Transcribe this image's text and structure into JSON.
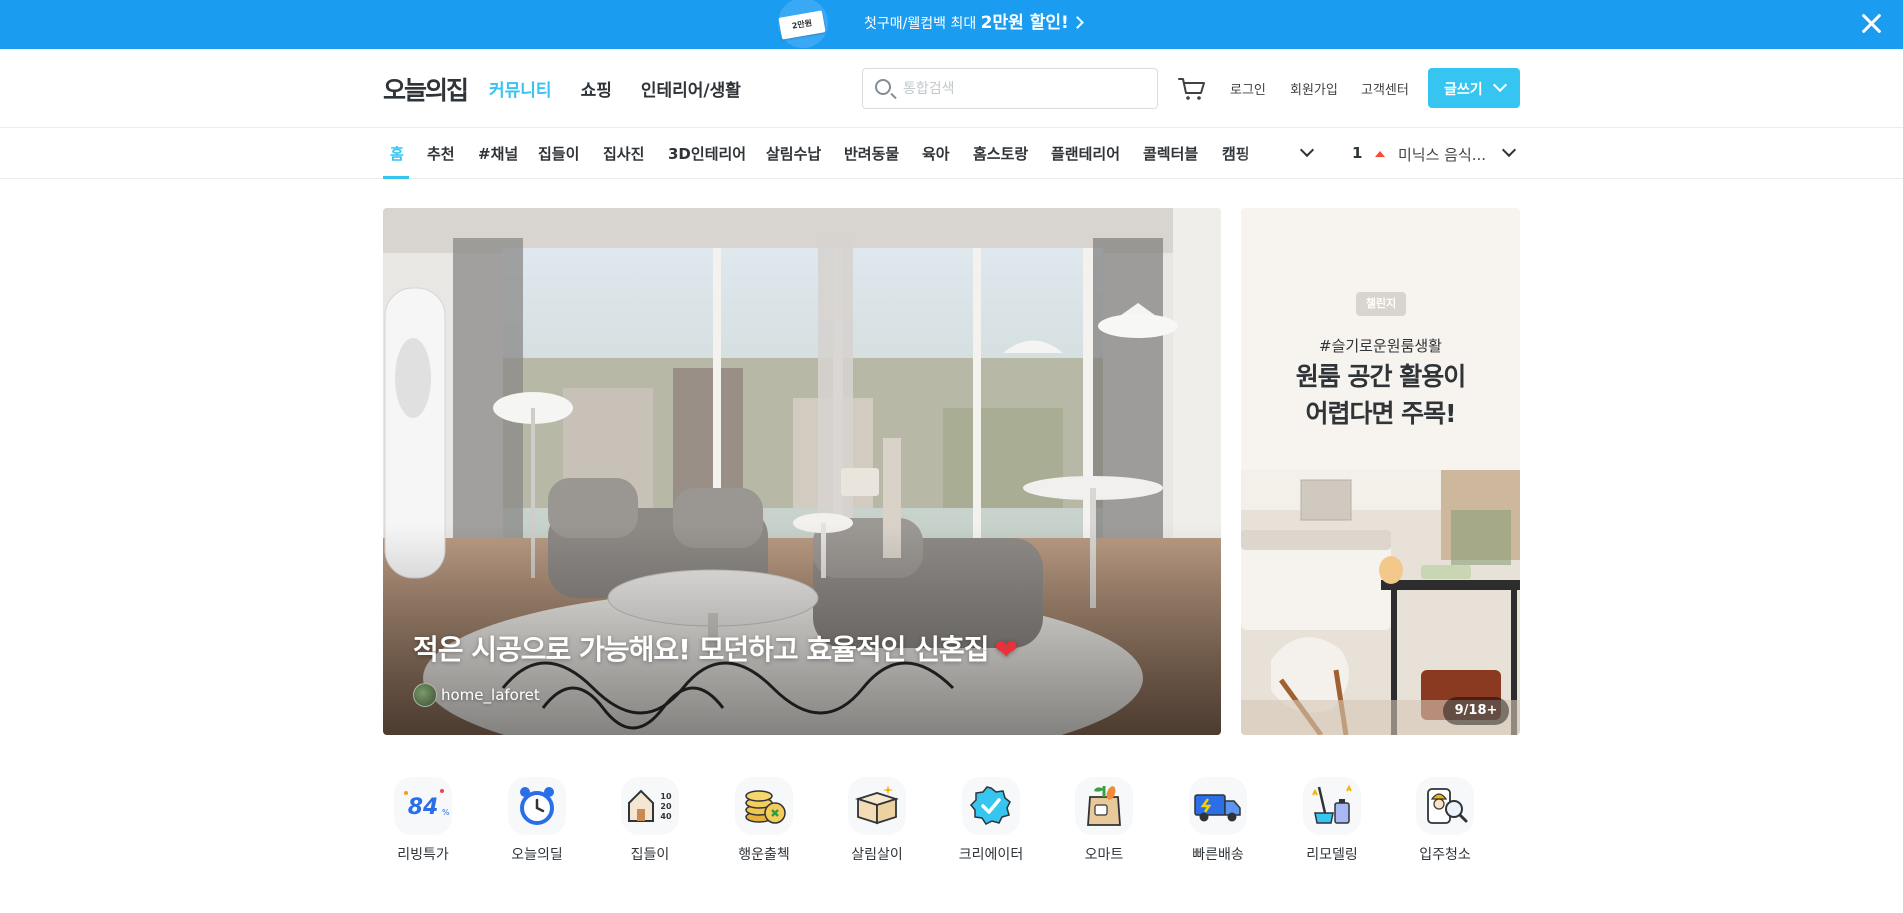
{
  "promo": {
    "coupon_text": "2만원",
    "message_prefix": "첫구매/웰컴백 최대 ",
    "message_bold": "2만원 할인!"
  },
  "header": {
    "logo": "오늘의집",
    "nav": [
      "커뮤니티",
      "쇼핑",
      "인테리어/생활"
    ],
    "search_placeholder": "통합검색",
    "login": "로그인",
    "signup": "회원가입",
    "support": "고객센터",
    "write": "글쓰기"
  },
  "subnav": {
    "items": [
      "홈",
      "추천",
      "#채널",
      "집들이",
      "집사진",
      "3D인테리어",
      "살림수납",
      "반려동물",
      "육아",
      "홈스토랑",
      "플랜테리어",
      "콜렉터블",
      "캠핑"
    ],
    "active_index": 0,
    "ranking_number": "1",
    "ranking_keyword": "미닉스 음식..."
  },
  "hero": {
    "title": "적은 시공으로 가능해요! 모던하고 효율적인 신혼집",
    "title_emoji": "❤",
    "author": "home_laforet"
  },
  "side_banner": {
    "tag": "챌린지",
    "hashtag": "#슬기로운원룸생활",
    "headline_line1": "원룸 공간 활용이",
    "headline_line2": "어렵다면 주목!",
    "pager": "9/18+"
  },
  "quick_menu": [
    {
      "label": "리빙특가",
      "icon": "living-deal-icon"
    },
    {
      "label": "오늘의딜",
      "icon": "alarm-clock-icon"
    },
    {
      "label": "집들이",
      "icon": "house-size-icon"
    },
    {
      "label": "행운출첵",
      "icon": "coins-icon"
    },
    {
      "label": "살림살이",
      "icon": "box-icon"
    },
    {
      "label": "크리에이터",
      "icon": "verified-badge-icon"
    },
    {
      "label": "오마트",
      "icon": "grocery-bag-icon"
    },
    {
      "label": "빠른배송",
      "icon": "delivery-truck-icon"
    },
    {
      "label": "리모델링",
      "icon": "remodeling-icon"
    },
    {
      "label": "입주청소",
      "icon": "cleaning-worker-icon"
    }
  ],
  "colors": {
    "promo_bg": "#1a9cf0",
    "accent": "#35c5f0",
    "text": "#2f3438",
    "rank_up": "#f74b2e"
  }
}
